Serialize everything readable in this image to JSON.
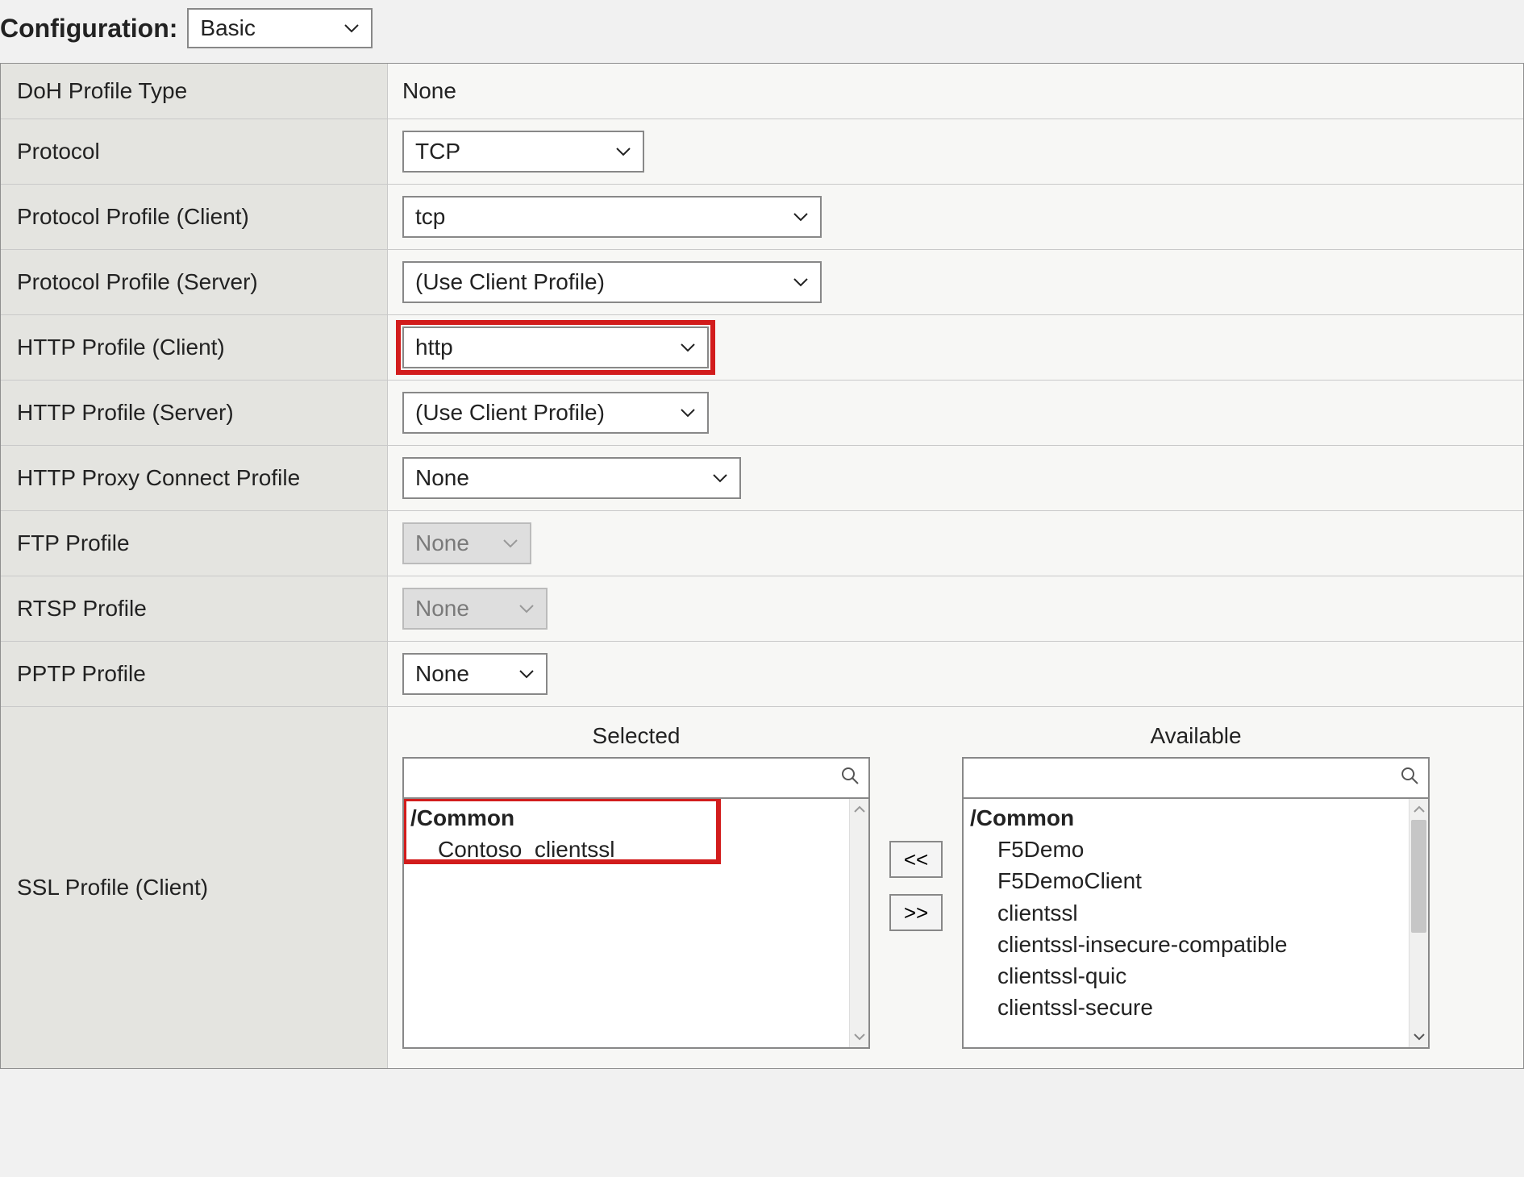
{
  "header": {
    "configuration_label": "Configuration:",
    "configuration_value": "Basic"
  },
  "rows": {
    "doh_profile_type": {
      "label": "DoH Profile Type",
      "value": "None"
    },
    "protocol": {
      "label": "Protocol",
      "value": "TCP"
    },
    "protocol_profile_client": {
      "label": "Protocol Profile (Client)",
      "value": "tcp"
    },
    "protocol_profile_server": {
      "label": "Protocol Profile (Server)",
      "value": "(Use Client Profile)"
    },
    "http_profile_client": {
      "label": "HTTP Profile (Client)",
      "value": "http"
    },
    "http_profile_server": {
      "label": "HTTP Profile (Server)",
      "value": "(Use Client Profile)"
    },
    "http_proxy_connect_profile": {
      "label": "HTTP Proxy Connect Profile",
      "value": "None"
    },
    "ftp_profile": {
      "label": "FTP Profile",
      "value": "None"
    },
    "rtsp_profile": {
      "label": "RTSP Profile",
      "value": "None"
    },
    "pptp_profile": {
      "label": "PPTP Profile",
      "value": "None"
    }
  },
  "ssl_profile_client": {
    "label": "SSL Profile (Client)",
    "selected_header": "Selected",
    "available_header": "Available",
    "selected_group": "/Common",
    "selected_items": [
      "Contoso_clientssl"
    ],
    "available_group": "/Common",
    "available_items": [
      "F5Demo",
      "F5DemoClient",
      "clientssl",
      "clientssl-insecure-compatible",
      "clientssl-quic",
      "clientssl-secure"
    ],
    "move_left": "<<",
    "move_right": ">>"
  }
}
